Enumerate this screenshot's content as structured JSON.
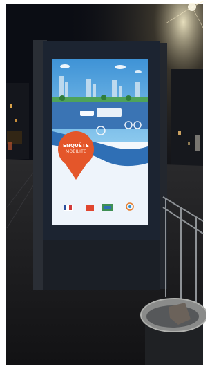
{
  "poster": {
    "pin_title": "ENQUÊTE",
    "pin_subtitle": "MOBILITÉ",
    "logos": [
      "republique-francaise-logo",
      "region-logo",
      "department-logo",
      "community-logo"
    ]
  },
  "colors": {
    "night_sky": "#0b0d14",
    "poster_sky": "#3f93d6",
    "poster_ground": "#eef4fb",
    "pin_orange": "#e4562a",
    "kiosk_frame": "#1c2431"
  }
}
